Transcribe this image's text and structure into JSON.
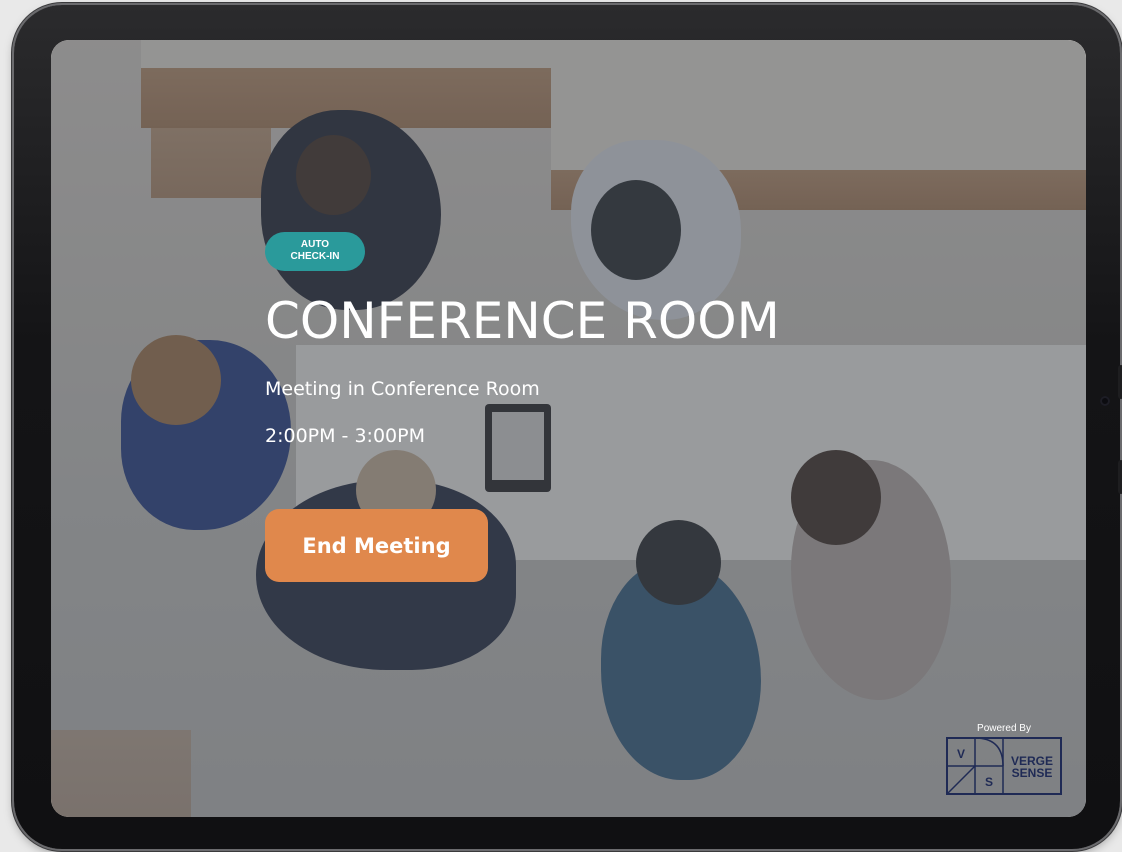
{
  "screen": {
    "badge": "AUTO\nCHECK-IN",
    "room_title": "CONFERENCE ROOM",
    "meeting_name": "Meeting in Conference Room",
    "time_range": "2:00PM - 3:00PM",
    "end_button_label": "End Meeting",
    "powered_by": "Powered By",
    "logo": {
      "letter_v": "V",
      "letter_s": "S",
      "word_1": "VERGE",
      "word_2": "SENSE"
    }
  },
  "colors": {
    "badge": "#2a9a9b",
    "button": "#e0884c",
    "overlay": "#464a50",
    "logo": "#1f2a55"
  }
}
